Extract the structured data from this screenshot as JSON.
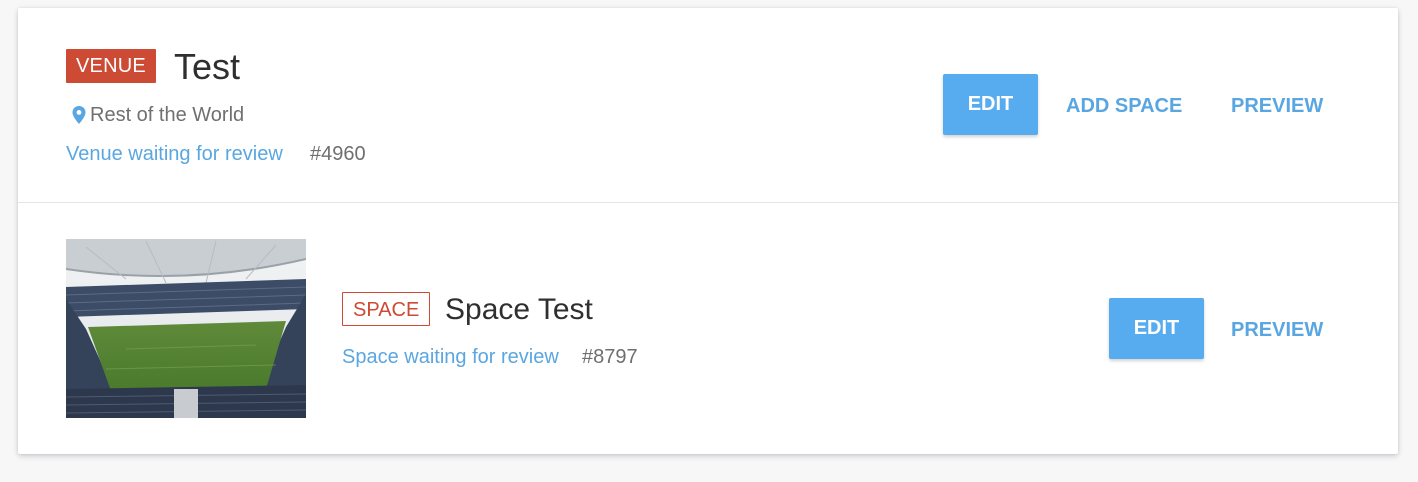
{
  "venue": {
    "badge": "VENUE",
    "title": "Test",
    "location": "Rest of the World",
    "status": "Venue waiting for review",
    "id": "#4960",
    "buttons": {
      "edit": "EDIT",
      "add_space": "ADD SPACE",
      "preview": "PREVIEW"
    }
  },
  "space": {
    "badge": "SPACE",
    "title": "Space Test",
    "status": "Space waiting for review",
    "id": "#8797",
    "image_alt": "stadium",
    "buttons": {
      "edit": "EDIT",
      "preview": "PREVIEW"
    }
  },
  "icons": {
    "location": "map-pin-icon"
  },
  "colors": {
    "venue_badge": "#cd4a34",
    "accent_blue": "#56acee",
    "link_blue": "#5aa6e0"
  }
}
